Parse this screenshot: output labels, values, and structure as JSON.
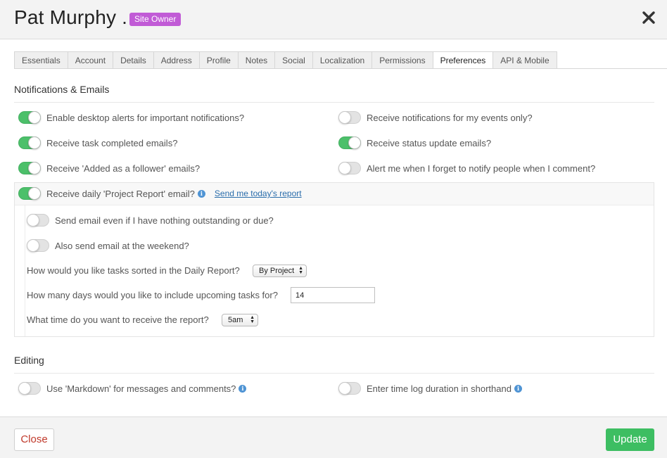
{
  "header": {
    "user_name": "Pat Murphy .",
    "role_badge": "Site Owner",
    "close_icon": "close-icon"
  },
  "tabs": [
    {
      "label": "Essentials"
    },
    {
      "label": "Account"
    },
    {
      "label": "Details"
    },
    {
      "label": "Address"
    },
    {
      "label": "Profile"
    },
    {
      "label": "Notes"
    },
    {
      "label": "Social"
    },
    {
      "label": "Localization"
    },
    {
      "label": "Permissions"
    },
    {
      "label": "Preferences",
      "active": true
    },
    {
      "label": "API & Mobile"
    }
  ],
  "notifications": {
    "title": "Notifications & Emails",
    "options": [
      {
        "label": "Enable desktop alerts for important notifications?",
        "enabled": true
      },
      {
        "label": "Receive notifications for my events only?",
        "enabled": false
      },
      {
        "label": "Receive task completed emails?",
        "enabled": true
      },
      {
        "label": "Receive status update emails?",
        "enabled": true
      },
      {
        "label": "Receive 'Added as a follower' emails?",
        "enabled": true
      },
      {
        "label": "Alert me when I forget to notify people when I comment?",
        "enabled": false
      }
    ]
  },
  "daily_report": {
    "label": "Receive daily 'Project Report' email?",
    "enabled": true,
    "link": "Send me today's report",
    "options": [
      {
        "label": "Send email even if I have nothing outstanding or due?",
        "enabled": false
      },
      {
        "label": "Also send email at the weekend?",
        "enabled": false
      }
    ],
    "sort_question": "How would you like tasks sorted in the Daily Report?",
    "sort_value": "By Project",
    "days_question": "How many days would you like to include upcoming tasks for?",
    "days_value": "14",
    "time_question": "What time do you want to receive the report?",
    "time_value": "5am"
  },
  "editing": {
    "title": "Editing",
    "options": [
      {
        "label": "Use 'Markdown' for messages and comments?",
        "enabled": false
      },
      {
        "label": "Enter time log duration in shorthand",
        "enabled": false
      }
    ]
  },
  "footer": {
    "close_label": "Close",
    "update_label": "Update"
  },
  "colors": {
    "toggle_on": "#4cc06a",
    "badge": "#c15bd6",
    "update_button": "#3dbe62",
    "close_text": "#c0392b",
    "link": "#2a6dab",
    "info_icon": "#4f94d4"
  }
}
